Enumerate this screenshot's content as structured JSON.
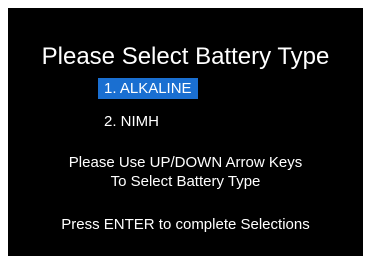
{
  "colors": {
    "background": "#000000",
    "text": "#ffffff",
    "highlight": "#1a6fd1"
  },
  "screen": {
    "title": "Please Select Battery Type",
    "options": [
      {
        "label": "1. ALKALINE",
        "selected": true
      },
      {
        "label": "2. NIMH",
        "selected": false
      }
    ],
    "instructions": {
      "line1": "Please Use UP/DOWN Arrow Keys",
      "line2": "To Select Battery Type"
    },
    "footer": "Press ENTER to complete Selections"
  }
}
